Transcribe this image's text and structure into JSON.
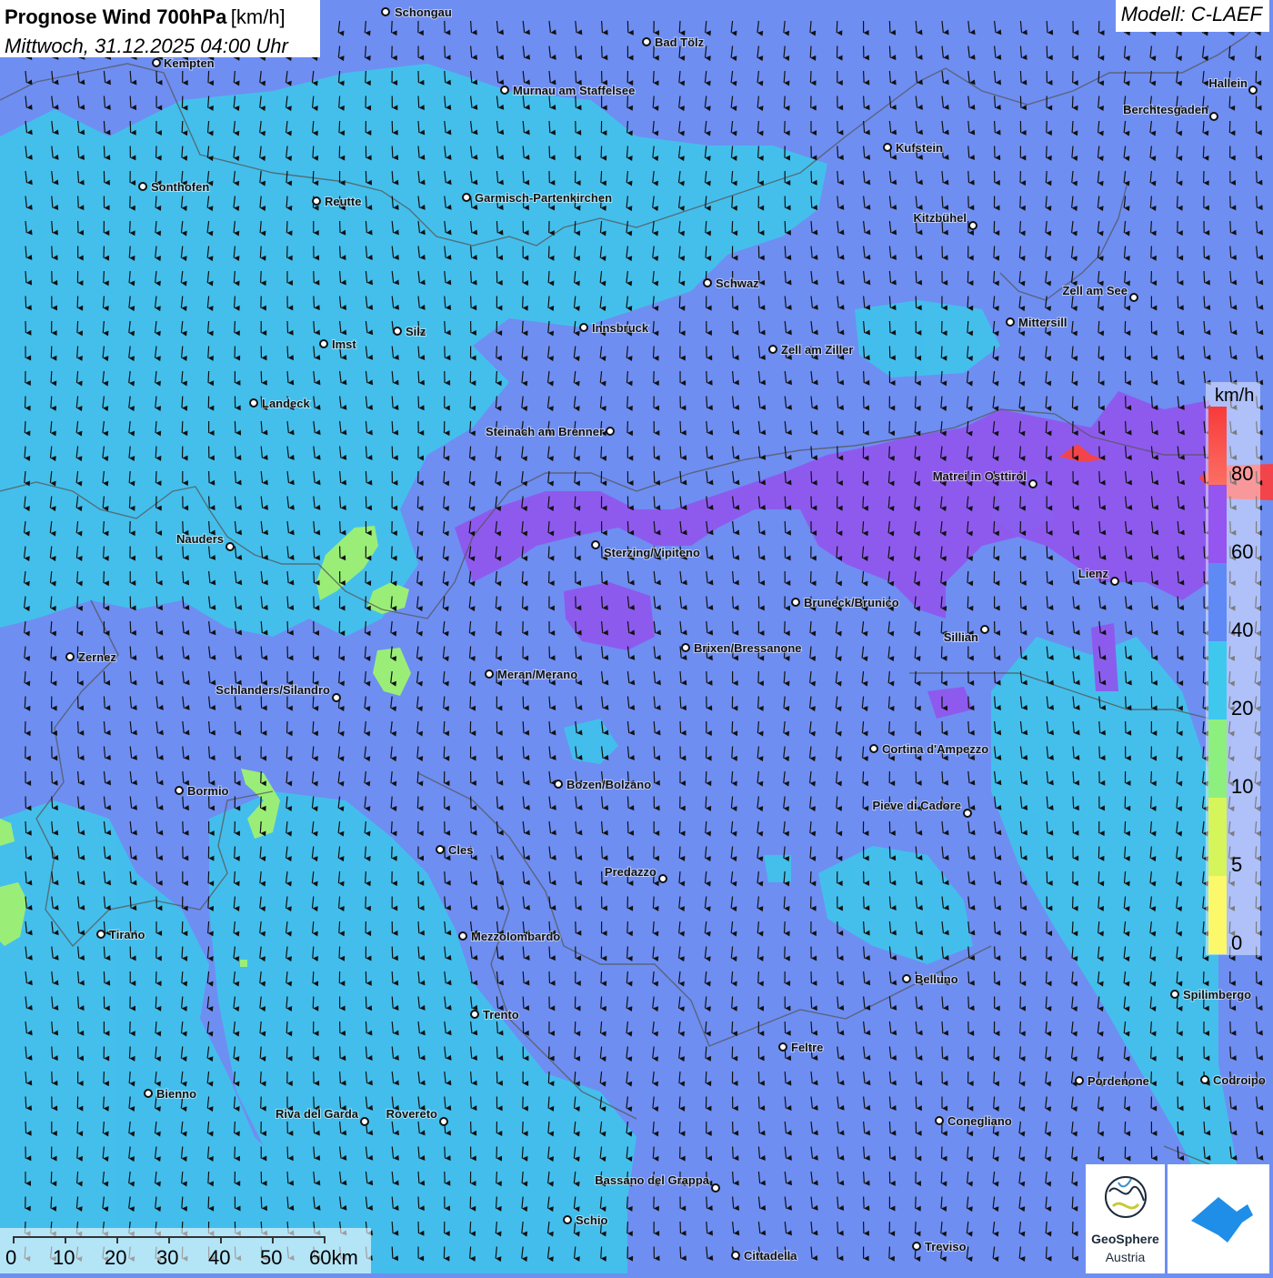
{
  "title": {
    "main": "Prognose Wind 700hPa",
    "unit": "[km/h]",
    "date": "Mittwoch, 31.12.2025 04:00 Uhr"
  },
  "model": "Modell: C-LAEF",
  "legend": {
    "unit": "km/h",
    "labels": [
      "80",
      "60",
      "40",
      "20",
      "10",
      "5",
      "0"
    ],
    "colors": [
      "#f83a3a",
      "#9455f0",
      "#5f8af5",
      "#3ec8ee",
      "#8df07e",
      "#d6f55a",
      "#fbf96a"
    ]
  },
  "scale_bar": {
    "labels": [
      "0",
      "10",
      "20",
      "30",
      "40",
      "50",
      "60km"
    ]
  },
  "logo": {
    "name": "GeoSphere",
    "sub": "Austria"
  },
  "wind": {
    "direction": "from north (arrows pointing south)",
    "dominant_speed_class": "20-40 km/h"
  },
  "cities": [
    {
      "name": "Schongau"
    },
    {
      "name": "Bad Tölz"
    },
    {
      "name": "Kempten"
    },
    {
      "name": "Murnau am Staffelsee"
    },
    {
      "name": "Hallein"
    },
    {
      "name": "Berchtesgaden"
    },
    {
      "name": "Kufstein"
    },
    {
      "name": "Sonthofen"
    },
    {
      "name": "Reutte"
    },
    {
      "name": "Garmisch-Partenkirchen"
    },
    {
      "name": "Kitzbühel"
    },
    {
      "name": "Schwaz"
    },
    {
      "name": "Zell am See"
    },
    {
      "name": "Mittersill"
    },
    {
      "name": "Innsbruck"
    },
    {
      "name": "Silz"
    },
    {
      "name": "Imst"
    },
    {
      "name": "Zell am Ziller"
    },
    {
      "name": "Landeck"
    },
    {
      "name": "Steinach am Brenner"
    },
    {
      "name": "Matrei in Osttirol"
    },
    {
      "name": "Nauders"
    },
    {
      "name": "Sterzing/Vipiteno"
    },
    {
      "name": "Lienz"
    },
    {
      "name": "Bruneck/Brunico"
    },
    {
      "name": "Sillian"
    },
    {
      "name": "Brixen/Bressanone"
    },
    {
      "name": "Zernez"
    },
    {
      "name": "Meran/Merano"
    },
    {
      "name": "Schlanders/Silandro"
    },
    {
      "name": "Cortina d'Ampezzo"
    },
    {
      "name": "Bozen/Bolzano"
    },
    {
      "name": "Bormio"
    },
    {
      "name": "Pieve di Cadore"
    },
    {
      "name": "Cles"
    },
    {
      "name": "Predazzo"
    },
    {
      "name": "Tirano"
    },
    {
      "name": "Mezzolombardo"
    },
    {
      "name": "Belluno"
    },
    {
      "name": "Spilimbergo"
    },
    {
      "name": "Trento"
    },
    {
      "name": "Feltre"
    },
    {
      "name": "Bienno"
    },
    {
      "name": "Pordenone"
    },
    {
      "name": "Codroipo"
    },
    {
      "name": "Riva del Garda"
    },
    {
      "name": "Rovereto"
    },
    {
      "name": "Conegliano"
    },
    {
      "name": "Bassano del Grappa"
    },
    {
      "name": "Schio"
    },
    {
      "name": "Treviso"
    },
    {
      "name": "Cittadella"
    }
  ]
}
